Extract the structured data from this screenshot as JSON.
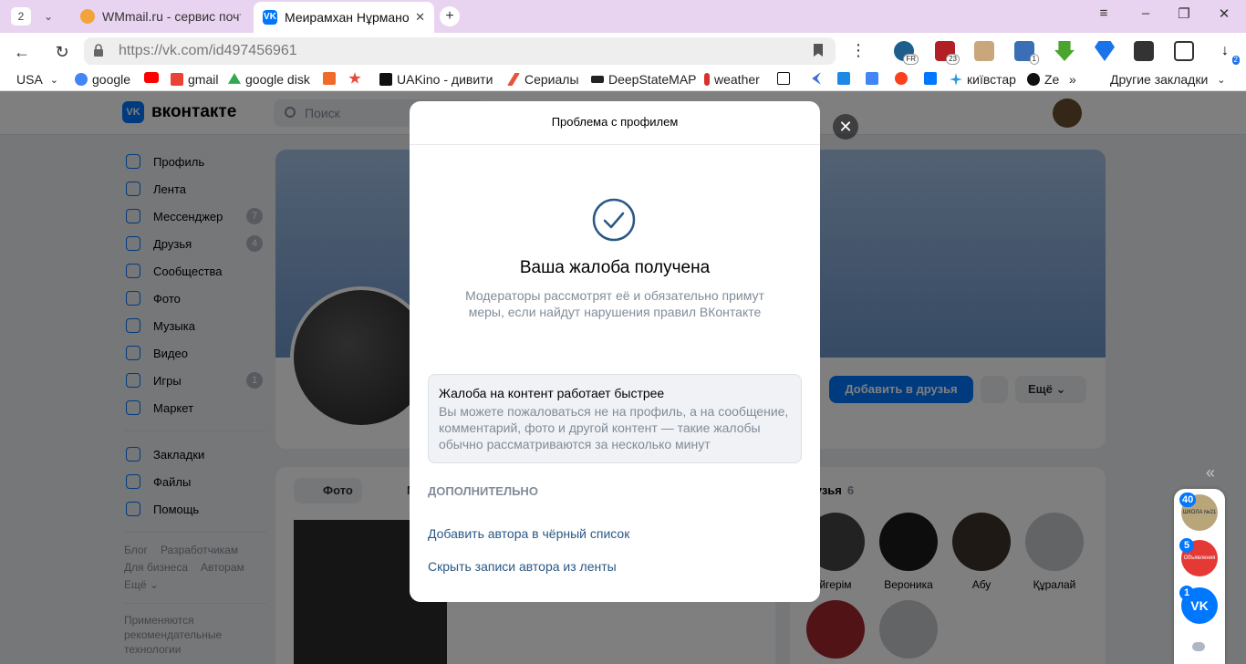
{
  "browser": {
    "tab_count": "2",
    "tabs": [
      {
        "title": "WMmail.ru - сервис почто",
        "active": false
      },
      {
        "title": "Меирамхан Нұрманов",
        "active": true
      }
    ],
    "url": "https://vk.com/id497456961",
    "bookmarks": [
      "USA",
      "google",
      "gmail",
      "google disk",
      "UAKino - дивитис",
      "Сериалы",
      "DeepStateMAP",
      "weather",
      "київстар",
      "Ze"
    ],
    "other_bookmarks": "Другие закладки",
    "ext_badges": {
      "fr": "FR",
      "ublock": "23",
      "tab": "1",
      "downloads": "2"
    }
  },
  "vk": {
    "logo": "вконтакте",
    "search_placeholder": "Поиск",
    "nav": [
      {
        "label": "Профиль",
        "count": ""
      },
      {
        "label": "Лента",
        "count": ""
      },
      {
        "label": "Мессенджер",
        "count": "7"
      },
      {
        "label": "Друзья",
        "count": "4"
      },
      {
        "label": "Сообщества",
        "count": ""
      },
      {
        "label": "Фото",
        "count": ""
      },
      {
        "label": "Музыка",
        "count": ""
      },
      {
        "label": "Видео",
        "count": ""
      },
      {
        "label": "Игры",
        "count": "1"
      },
      {
        "label": "Маркет",
        "count": ""
      }
    ],
    "nav2": [
      {
        "label": "Закладки"
      },
      {
        "label": "Файлы"
      },
      {
        "label": "Помощь"
      }
    ],
    "footer_links": [
      "Блог",
      "Разработчикам",
      "Для бизнеса",
      "Авторам",
      "Ещё ⌄"
    ],
    "rec_note": "Применяются рекомендательные технологии",
    "add_friend": "Добавить в друзья",
    "more": "Ещё",
    "photos_tab": "Фото",
    "music_tab_partial": "М",
    "friends_title": "рузья",
    "friends_count": "6",
    "friends": [
      "йгерім",
      "Вероника",
      "Абу",
      "Құралай"
    ],
    "chat_badges": [
      "40",
      "5",
      "1"
    ],
    "chat_labels": [
      "ШКОЛА №21",
      "Объявления"
    ]
  },
  "modal": {
    "header": "Проблема с профилем",
    "title": "Ваша жалоба получена",
    "description": "Модераторы рассмотрят её и обязательно примут меры, если найдут нарушения правил ВКонтакте",
    "hint_title": "Жалоба на контент работает быстрее",
    "hint_text": "Вы можете пожаловаться не на профиль, а на сообщение, комментарий, фото и другой контент — такие жалобы обычно рассматриваются за несколько минут",
    "extra_heading": "ДОПОЛНИТЕЛЬНО",
    "link_blacklist": "Добавить автора в чёрный список",
    "link_hide": "Скрыть записи автора из ленты"
  },
  "colors": {
    "vk_blue": "#0077ff",
    "link": "#2a5885",
    "muted": "#818c99",
    "tabbar": "#e8d4f0"
  }
}
